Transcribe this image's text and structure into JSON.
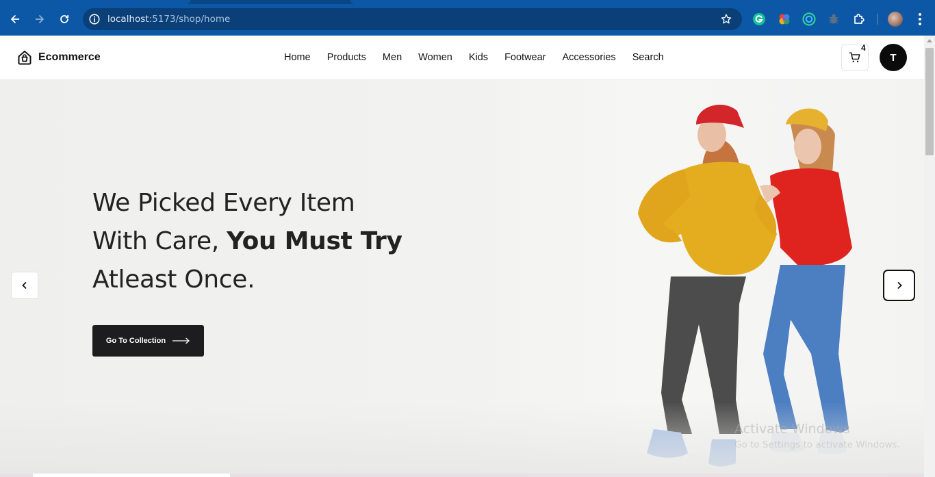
{
  "browser": {
    "url_host": "localhost",
    "url_path": ":5173/shop/home",
    "icons": [
      "back-arrow-icon",
      "forward-arrow-icon",
      "reload-icon",
      "site-info-icon",
      "bookmark-star-icon",
      "grammarly-icon",
      "color-wheel-icon",
      "target-extension-icon",
      "bug-extension-icon",
      "puzzle-extensions-icon",
      "kebab-menu-icon"
    ]
  },
  "header": {
    "logo_text": "Ecommerce",
    "nav": [
      "Home",
      "Products",
      "Men",
      "Women",
      "Kids",
      "Footwear",
      "Accessories",
      "Search"
    ],
    "cart_count": "4",
    "avatar_letter": "T"
  },
  "hero": {
    "line1": "We Picked Every Item",
    "line2_pre": "With Care,",
    "line2_bold": "You Must Try",
    "line3": "Atleast Once.",
    "cta_label": "Go To Collection"
  },
  "watermark": {
    "line1": "Activate Windows",
    "line2": "Go to Settings to activate Windows."
  },
  "colors": {
    "chrome": "#0c57a6",
    "cta_bg": "#1d1d1f",
    "hero_bg": "#f2f2f0"
  }
}
